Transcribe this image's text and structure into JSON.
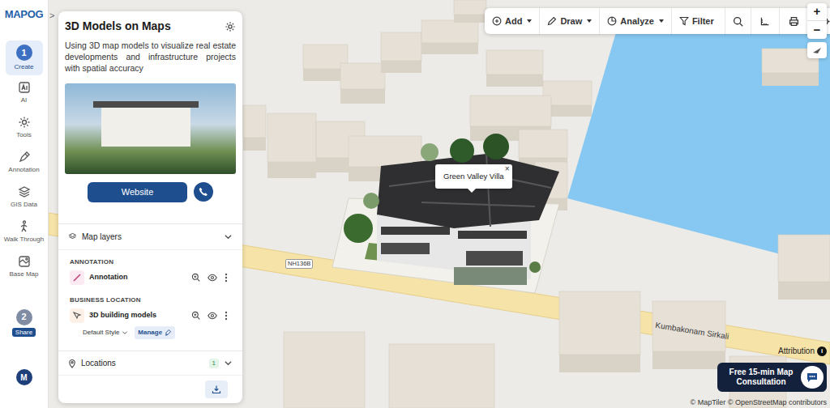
{
  "rail": {
    "logo": "MAPOG",
    "collapse": ">",
    "items": [
      {
        "label": "Create",
        "kind": "step",
        "badge": "1",
        "selected": true
      },
      {
        "label": "AI",
        "kind": "tool",
        "selected": false
      },
      {
        "label": "Tools",
        "kind": "tool",
        "selected": false
      },
      {
        "label": "Annotation",
        "kind": "tool",
        "selected": false
      },
      {
        "label": "GIS Data",
        "kind": "tool",
        "selected": false
      },
      {
        "label": "Walk Through",
        "kind": "tool",
        "selected": false
      },
      {
        "label": "Base Map",
        "kind": "tool",
        "selected": false
      },
      {
        "label": "Share",
        "kind": "step",
        "badge": "2",
        "selected": false
      }
    ],
    "user": "M"
  },
  "panel": {
    "title": "3D Models on Maps",
    "description": "Using 3D map models to visualize real estate developments and infrastructure projects with spatial accuracy",
    "website": "Website",
    "layers": {
      "label": "Map layers",
      "expanded": true,
      "groups": [
        {
          "heading": "ANNOTATION",
          "layers": [
            {
              "name": "Annotation",
              "kind": "line",
              "visible": true
            }
          ]
        },
        {
          "heading": "BUSINESS LOCATION",
          "layers": [
            {
              "name": "3D building models",
              "kind": "model",
              "visible": true,
              "style": "Default Style",
              "manage": "Manage"
            }
          ]
        }
      ]
    },
    "locations": {
      "label": "Locations",
      "count": "1",
      "expanded": false
    }
  },
  "toolbar": {
    "items": [
      {
        "label": "Add",
        "dropdown": true
      },
      {
        "label": "Draw",
        "dropdown": true
      },
      {
        "label": "Analyze",
        "dropdown": true
      },
      {
        "label": "Filter",
        "dropdown": false
      }
    ],
    "alert": true
  },
  "zoom": {
    "in": "+",
    "out": "−"
  },
  "map": {
    "popup": {
      "title": "Green Valley Villa",
      "close": "×"
    },
    "roads": [
      {
        "label": "NH136B"
      },
      {
        "label": "Kumbakonam Sirkali"
      }
    ]
  },
  "consultation": {
    "label": "Free 15-min Map Consultation"
  },
  "attribution": {
    "label": "Attribution",
    "info": "i",
    "credits": "© MapTiler © OpenStreetMap contributors"
  }
}
